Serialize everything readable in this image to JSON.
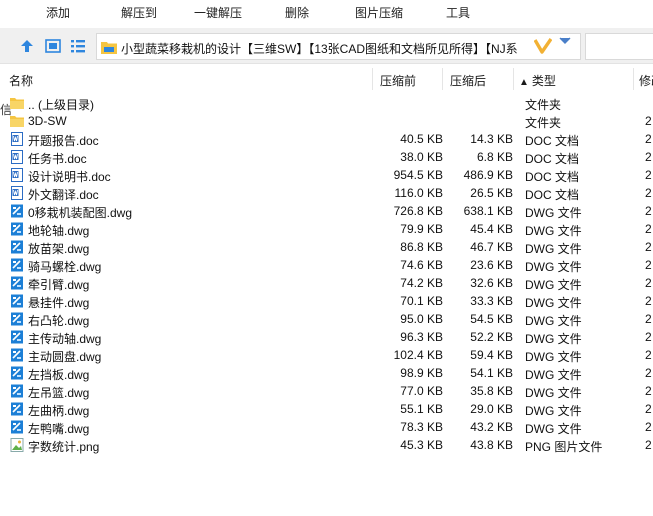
{
  "toolbar": {
    "buttons": [
      {
        "label": "添加"
      },
      {
        "label": "解压到"
      },
      {
        "label": "一键解压"
      },
      {
        "label": "删除"
      },
      {
        "label": "图片压缩"
      },
      {
        "label": "工具"
      }
    ]
  },
  "address": {
    "path": "小型蔬菜移栽机的设计【三维SW】【13张CAD图纸和文档所见所得】【NJ系"
  },
  "columns": {
    "name": "名称",
    "compressed_size": "压缩前",
    "original_size": "压缩后",
    "type": "类型",
    "date": "修改"
  },
  "sort_indicator": "▲",
  "left_fragment": "信",
  "files": [
    {
      "name": ".. (上级目录)",
      "csize": "",
      "osize": "",
      "type": "文件夹",
      "date": "",
      "icon": "folder-icon"
    },
    {
      "name": "3D-SW",
      "csize": "",
      "osize": "",
      "type": "文件夹",
      "date": "2",
      "icon": "folder-icon"
    },
    {
      "name": "开题报告.doc",
      "csize": "40.5 KB",
      "osize": "14.3 KB",
      "type": "DOC 文档",
      "date": "2",
      "icon": "doc-icon"
    },
    {
      "name": "任务书.doc",
      "csize": "38.0 KB",
      "osize": "6.8 KB",
      "type": "DOC 文档",
      "date": "2",
      "icon": "doc-icon"
    },
    {
      "name": "设计说明书.doc",
      "csize": "954.5 KB",
      "osize": "486.9 KB",
      "type": "DOC 文档",
      "date": "2",
      "icon": "doc-icon"
    },
    {
      "name": "外文翻译.doc",
      "csize": "116.0 KB",
      "osize": "26.5 KB",
      "type": "DOC 文档",
      "date": "2",
      "icon": "doc-icon"
    },
    {
      "name": "0移栽机装配图.dwg",
      "csize": "726.8 KB",
      "osize": "638.1 KB",
      "type": "DWG 文件",
      "date": "2",
      "icon": "dwg-icon"
    },
    {
      "name": "地轮轴.dwg",
      "csize": "79.9 KB",
      "osize": "45.4 KB",
      "type": "DWG 文件",
      "date": "2",
      "icon": "dwg-icon"
    },
    {
      "name": "放苗架.dwg",
      "csize": "86.8 KB",
      "osize": "46.7 KB",
      "type": "DWG 文件",
      "date": "2",
      "icon": "dwg-icon"
    },
    {
      "name": "骑马螺栓.dwg",
      "csize": "74.6 KB",
      "osize": "23.6 KB",
      "type": "DWG 文件",
      "date": "2",
      "icon": "dwg-icon"
    },
    {
      "name": "牵引臂.dwg",
      "csize": "74.2 KB",
      "osize": "32.6 KB",
      "type": "DWG 文件",
      "date": "2",
      "icon": "dwg-icon"
    },
    {
      "name": "悬挂件.dwg",
      "csize": "70.1 KB",
      "osize": "33.3 KB",
      "type": "DWG 文件",
      "date": "2",
      "icon": "dwg-icon"
    },
    {
      "name": "右凸轮.dwg",
      "csize": "95.0 KB",
      "osize": "54.5 KB",
      "type": "DWG 文件",
      "date": "2",
      "icon": "dwg-icon"
    },
    {
      "name": "主传动轴.dwg",
      "csize": "96.3 KB",
      "osize": "52.2 KB",
      "type": "DWG 文件",
      "date": "2",
      "icon": "dwg-icon"
    },
    {
      "name": "主动圆盘.dwg",
      "csize": "102.4 KB",
      "osize": "59.4 KB",
      "type": "DWG 文件",
      "date": "2",
      "icon": "dwg-icon"
    },
    {
      "name": "左挡板.dwg",
      "csize": "98.9 KB",
      "osize": "54.1 KB",
      "type": "DWG 文件",
      "date": "2",
      "icon": "dwg-icon"
    },
    {
      "name": "左吊篮.dwg",
      "csize": "77.0 KB",
      "osize": "35.8 KB",
      "type": "DWG 文件",
      "date": "2",
      "icon": "dwg-icon"
    },
    {
      "name": "左曲柄.dwg",
      "csize": "55.1 KB",
      "osize": "29.0 KB",
      "type": "DWG 文件",
      "date": "2",
      "icon": "dwg-icon"
    },
    {
      "name": "左鸭嘴.dwg",
      "csize": "78.3 KB",
      "osize": "43.2 KB",
      "type": "DWG 文件",
      "date": "2",
      "icon": "dwg-icon"
    },
    {
      "name": "字数统计.png",
      "csize": "45.3 KB",
      "osize": "43.8 KB",
      "type": "PNG 图片文件",
      "date": "2",
      "icon": "png-icon"
    }
  ],
  "colors": {
    "folder": "#f5c542",
    "doc": "#2b6cc4",
    "dwg": "#1c7fd6",
    "png": "#5fb04a",
    "accent": "#f2b134"
  }
}
